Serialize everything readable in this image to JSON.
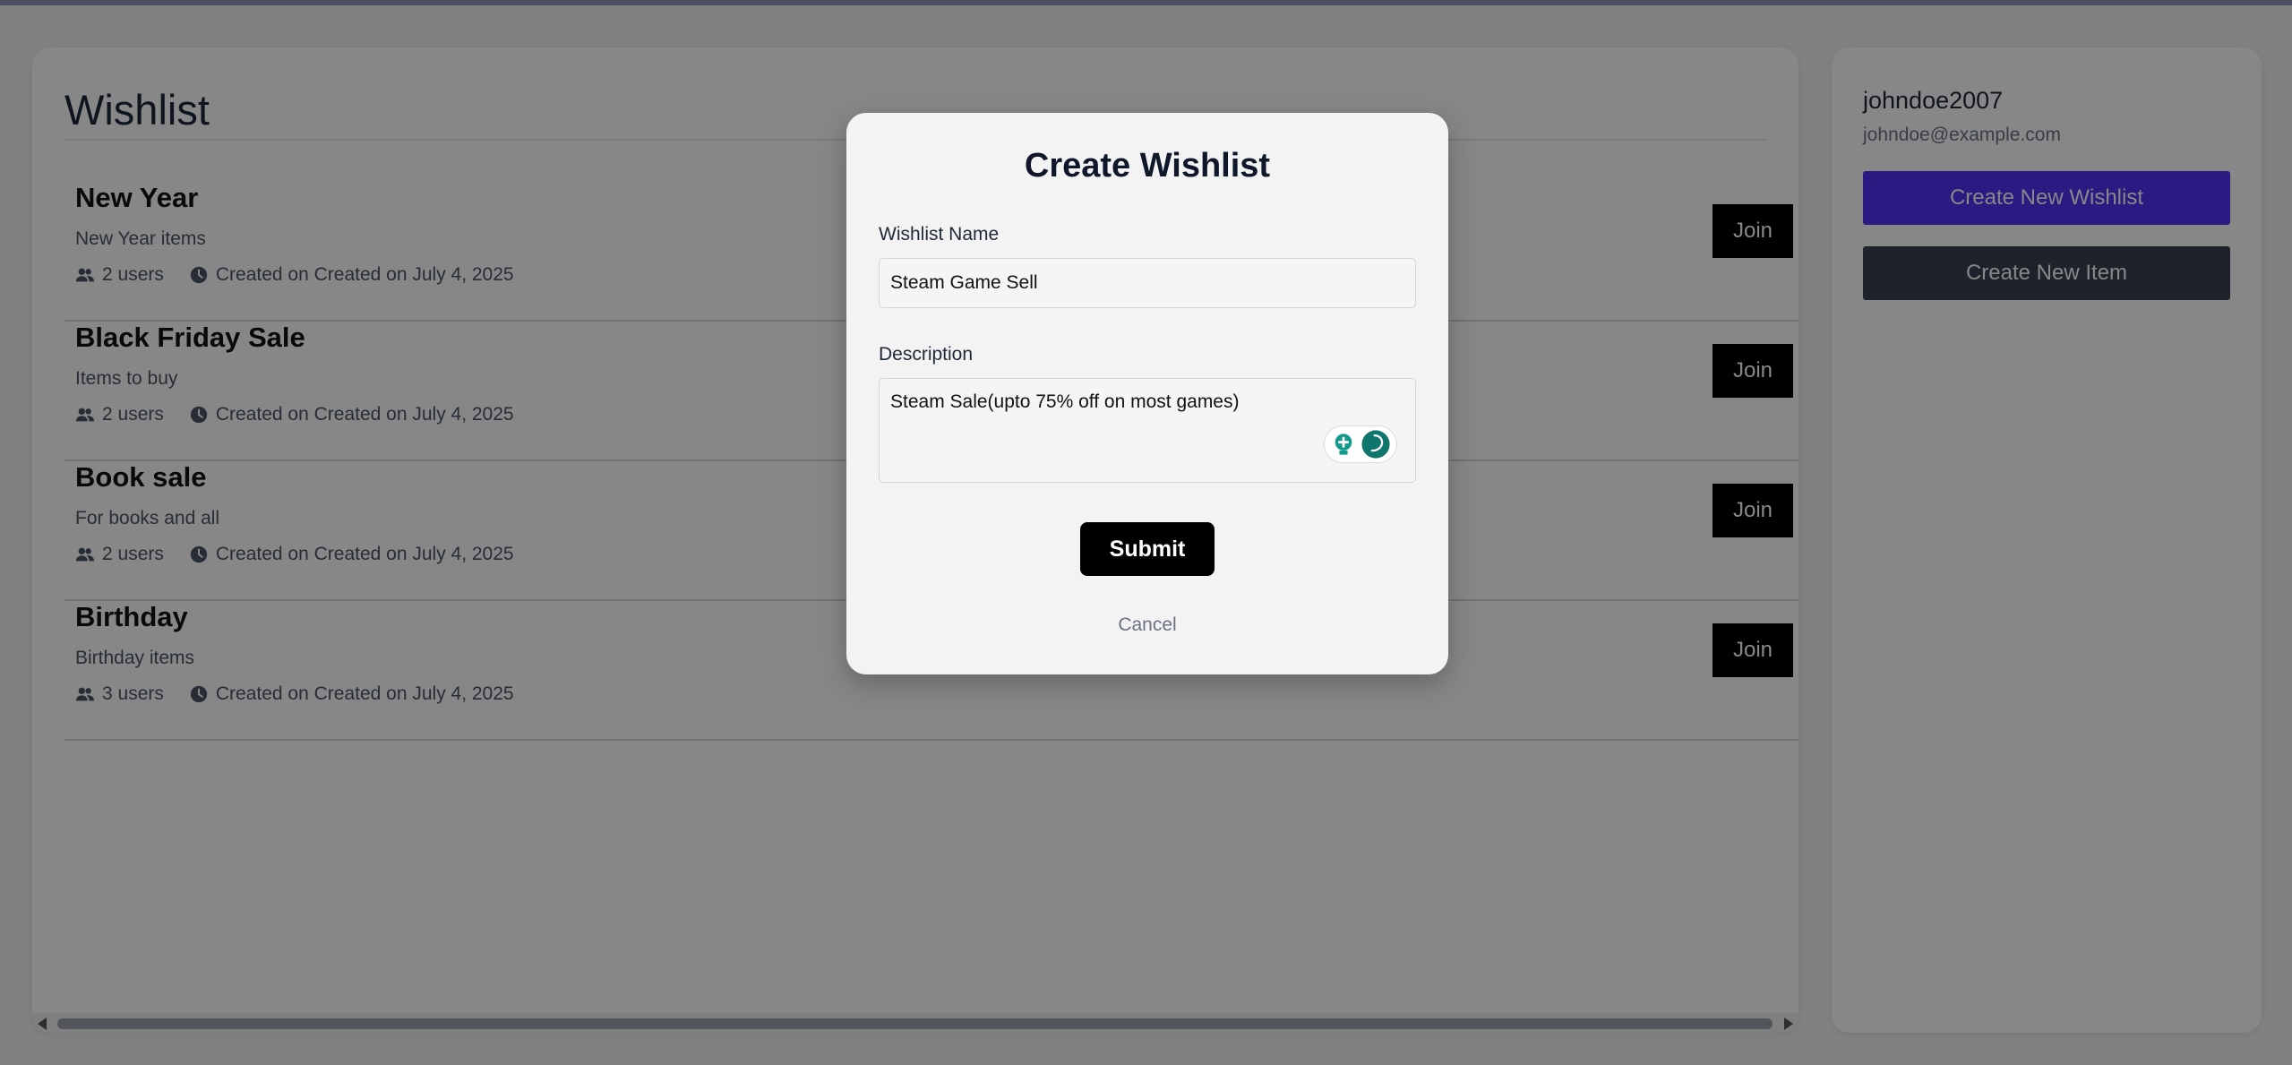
{
  "main": {
    "title": "Wishlist",
    "join_label": "Join",
    "wishlists": [
      {
        "name": "New Year",
        "description": "New Year items",
        "users": "2 users",
        "created": "Created on Created on July 4, 2025"
      },
      {
        "name": "Black Friday Sale",
        "description": "Items to buy",
        "users": "2 users",
        "created": "Created on Created on July 4, 2025"
      },
      {
        "name": "Book sale",
        "description": "For books and all",
        "users": "2 users",
        "created": "Created on Created on July 4, 2025"
      },
      {
        "name": "Birthday",
        "description": "Birthday items",
        "users": "3 users",
        "created": "Created on Created on July 4, 2025"
      }
    ]
  },
  "sidebar": {
    "username": "johndoe2007",
    "email": "johndoe@example.com",
    "create_wishlist_label": "Create New Wishlist",
    "create_item_label": "Create New Item"
  },
  "modal": {
    "title": "Create Wishlist",
    "name_label": "Wishlist Name",
    "name_value": "Steam Game Sell",
    "description_label": "Description",
    "description_value": "Steam Sale(upto 75% off on most games)",
    "submit_label": "Submit",
    "cancel_label": "Cancel"
  },
  "colors": {
    "primary_button": "#4f33f5",
    "secondary_button": "#374151",
    "join_button": "#000000",
    "overlay": "rgba(0,0,0,0.47)"
  },
  "icons": {
    "users": "users-icon",
    "clock": "clock-icon",
    "grammar": "grammar-assistant-icon"
  }
}
